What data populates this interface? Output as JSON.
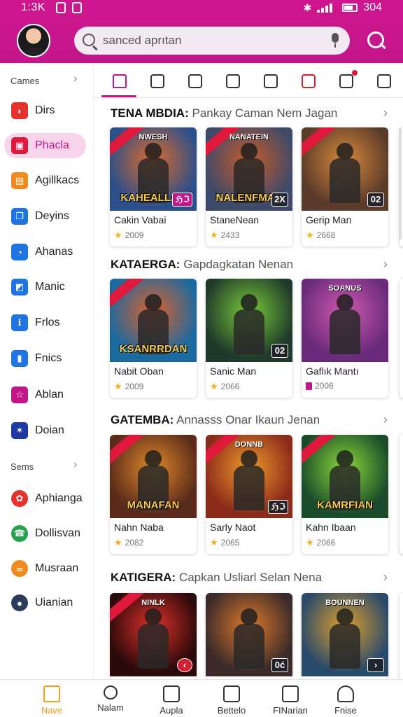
{
  "status_bar": {
    "time": "1:3K",
    "battery_label": "304"
  },
  "colors": {
    "brand": "#c2168a",
    "active_nav": "#f0a21b",
    "star": "#f2b21b"
  },
  "header": {
    "search": {
      "value": "sanced aprıtan"
    }
  },
  "sidebar": {
    "section_1": "Cames",
    "items_1": [
      {
        "label": "Dirs",
        "icon": "game-icon",
        "color": "#e5322d",
        "active": false
      },
      {
        "label": "Phacla",
        "icon": "controller-icon",
        "color": "#e0183b",
        "active": true
      },
      {
        "label": "Agillkacs",
        "icon": "calendar-icon",
        "color": "#f08a1e",
        "active": false
      },
      {
        "label": "Deyins",
        "icon": "copy-icon",
        "color": "#1e74e0",
        "active": false
      },
      {
        "label": "Ahanas",
        "icon": "chat-icon",
        "color": "#1e74e0",
        "active": false
      },
      {
        "label": "Manic",
        "icon": "tag-icon",
        "color": "#1e74e0",
        "active": false
      },
      {
        "label": "Frlos",
        "icon": "info-icon",
        "color": "#1e74e0",
        "active": false
      },
      {
        "label": "Fnics",
        "icon": "bar-icon",
        "color": "#1e74e0",
        "active": false
      },
      {
        "label": "Ablan",
        "icon": "star-outline-icon",
        "color": "#c2168a",
        "active": false
      },
      {
        "label": "Doian",
        "icon": "star-badge-icon",
        "color": "#1e3aa0",
        "active": false
      }
    ],
    "section_2": "Sems",
    "items_2": [
      {
        "label": "Aphianga",
        "icon": "pinwheel-icon",
        "color": "#e5322d"
      },
      {
        "label": "Dollisvan",
        "icon": "phone-icon",
        "color": "#23a34a"
      },
      {
        "label": "Musraan",
        "icon": "link-icon",
        "color": "#f08a1e"
      },
      {
        "label": "Uianian",
        "icon": "avatar-icon",
        "color": "#2a3b5c"
      }
    ]
  },
  "tabs": [
    "home-icon",
    "call-log-icon",
    "message-icon",
    "sync-icon",
    "browser-icon",
    "tag-icon",
    "gear-icon",
    "settings-icon"
  ],
  "sections": [
    {
      "prefix": "TENA MBDIA:",
      "subtitle": "Pankay Caman Nem Jagan",
      "cards": [
        {
          "cover_top": "NWESH",
          "cover_title": "KAHEALLAN",
          "title": "Cakin Vabai",
          "meta": "2009",
          "badge": "ℌℑ",
          "palette": [
            "#2a4f8a",
            "#e06a2a"
          ]
        },
        {
          "cover_top": "NANATEIN",
          "cover_title": "NALENFMAN",
          "title": "StaneNean",
          "meta": "2433",
          "badge": "2X",
          "palette": [
            "#3d4a6a",
            "#c95a2a"
          ]
        },
        {
          "cover_top": "",
          "cover_title": "",
          "title": "Gerip Man",
          "meta": "2668",
          "badge": "02",
          "palette": [
            "#5a3a2a",
            "#d98a3a"
          ]
        }
      ]
    },
    {
      "prefix": "KATAERGA:",
      "subtitle": "Gapdagkatan Nenan",
      "cards": [
        {
          "cover_top": "",
          "cover_title": "KSANRRDAN",
          "title": "Nabit Oban",
          "meta": "2009",
          "badge": "",
          "palette": [
            "#1a6aa0",
            "#e0602a"
          ]
        },
        {
          "cover_top": "",
          "cover_title": "",
          "title": "Sanic Man",
          "meta": "2066",
          "badge": "02",
          "palette": [
            "#1f3a2a",
            "#7acb3a"
          ]
        },
        {
          "cover_top": "SOANUS",
          "cover_title": "",
          "title": "Gaflık Mantı",
          "meta": "2006",
          "badge": "",
          "palette": [
            "#6a2a7a",
            "#d05ab0"
          ]
        }
      ]
    },
    {
      "prefix": "GATEMBA:",
      "subtitle": "Annasss Onar Ikaun Jenan",
      "cards": [
        {
          "cover_top": "",
          "cover_title": "MANAFAN",
          "title": "Nahn Naba",
          "meta": "2082",
          "badge": "",
          "palette": [
            "#5a2a1a",
            "#e08a2a"
          ]
        },
        {
          "cover_top": "DONNB",
          "cover_title": "",
          "title": "Sarly Naot",
          "meta": "2065",
          "badge": "ℌℑ",
          "palette": [
            "#8a2a1a",
            "#f09a2a"
          ]
        },
        {
          "cover_top": "",
          "cover_title": "KAMRFIAN",
          "title": "Kahn Ibaan",
          "meta": "2066",
          "badge": "",
          "palette": [
            "#1a4a2a",
            "#8adb3a"
          ]
        }
      ]
    },
    {
      "prefix": "KATIGERA:",
      "subtitle": "Capkan Usliarl Selan Nena",
      "cards": [
        {
          "cover_top": "NINLK",
          "cover_title": "",
          "title": "",
          "meta": "",
          "badge": "‹",
          "palette": [
            "#2a0a0a",
            "#e0302a"
          ]
        },
        {
          "cover_top": "",
          "cover_title": "",
          "title": "",
          "meta": "",
          "badge": "0ć",
          "palette": [
            "#3a2a2a",
            "#e07a2a"
          ]
        },
        {
          "cover_top": "BOUNNEN",
          "cover_title": "",
          "title": "",
          "meta": "",
          "badge": "›",
          "palette": [
            "#2a4a6a",
            "#e0a02a"
          ]
        }
      ]
    }
  ],
  "bottom_nav": [
    {
      "label": "Nave",
      "icon": "home-icon",
      "active": true
    },
    {
      "label": "Nalam",
      "icon": "search-icon",
      "active": false
    },
    {
      "label": "Aupla",
      "icon": "grid-icon",
      "active": false
    },
    {
      "label": "Bettelo",
      "icon": "tablet-icon",
      "active": false
    },
    {
      "label": "FINarian",
      "icon": "clipboard-icon",
      "active": false
    },
    {
      "label": "Fnise",
      "icon": "profile-icon",
      "active": false
    }
  ]
}
